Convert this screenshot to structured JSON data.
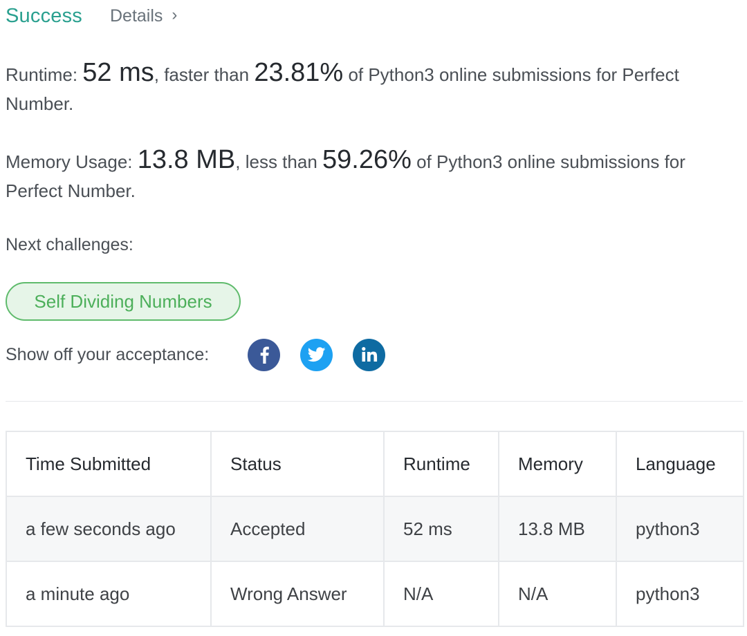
{
  "header": {
    "status_title": "Success",
    "details_link": "Details",
    "chevron_glyph": "›"
  },
  "runtime": {
    "label": "Runtime:",
    "value": "52 ms",
    "faster_text": ", faster than",
    "percent": "23.81%",
    "suffix": "of Python3 online submissions for Perfect Number."
  },
  "memory": {
    "label": "Memory Usage:",
    "value": "13.8 MB",
    "less_text": ", less than",
    "percent": "59.26%",
    "suffix": "of Python3 online submissions for Perfect Number."
  },
  "next_challenges": {
    "label": "Next challenges:",
    "items": [
      "Self Dividing Numbers"
    ]
  },
  "share": {
    "label": "Show off your acceptance:",
    "icons": [
      "facebook-icon",
      "twitter-icon",
      "linkedin-icon"
    ],
    "colors": {
      "facebook": "#3b5998",
      "twitter": "#1da1f2",
      "linkedin": "#0e6ba2"
    }
  },
  "submissions": {
    "columns": [
      "Time Submitted",
      "Status",
      "Runtime",
      "Memory",
      "Language"
    ],
    "rows": [
      {
        "time": "a few seconds ago",
        "status": "Accepted",
        "runtime": "52 ms",
        "memory": "13.8 MB",
        "language": "python3"
      },
      {
        "time": "a minute ago",
        "status": "Wrong Answer",
        "runtime": "N/A",
        "memory": "N/A",
        "language": "python3"
      }
    ]
  },
  "colors": {
    "accent": "#2aa08f",
    "accepted": "#2aa08f",
    "wrong_answer": "#c62828",
    "challenge_border": "#5fbb6c",
    "challenge_bg": "#e6f5e8"
  }
}
